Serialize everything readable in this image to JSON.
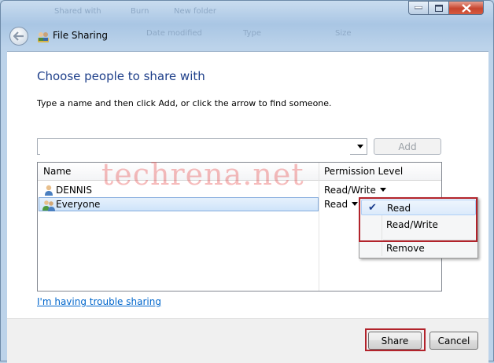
{
  "background_titles": [
    "Shared with",
    "Burn",
    "New folder",
    "Date modified",
    "Type",
    "Size"
  ],
  "window": {
    "title": "File Sharing"
  },
  "main": {
    "heading": "Choose people to share with",
    "instruction": "Type a name and then click Add, or click the arrow to find someone.",
    "name_input": {
      "value": "",
      "placeholder": ""
    },
    "add_label": "Add"
  },
  "list": {
    "columns": [
      "Name",
      "Permission Level"
    ],
    "rows": [
      {
        "name": "DENNIS",
        "permission": "Read/Write",
        "icon": "single-user-icon",
        "selected": false
      },
      {
        "name": "Everyone",
        "permission": "Read",
        "icon": "group-users-icon",
        "selected": true
      }
    ]
  },
  "permission_menu": {
    "items": [
      "Read",
      "Read/Write",
      "Remove"
    ],
    "checked": "Read"
  },
  "watermark": "techrena.net",
  "trouble_link": "I'm having trouble sharing",
  "buttons": {
    "share": "Share",
    "cancel": "Cancel"
  },
  "colors": {
    "heading": "#1e3f8a",
    "link": "#0066cc",
    "highlight_box": "#b2232b"
  }
}
